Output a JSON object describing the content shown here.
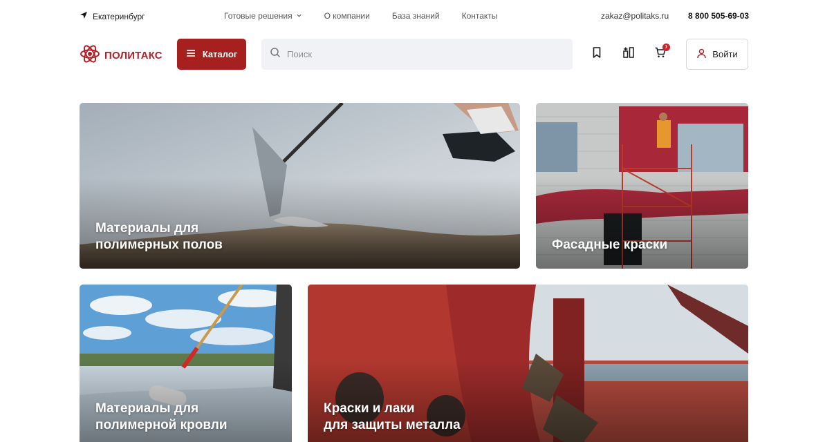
{
  "topbar": {
    "city": "Екатеринбург",
    "nav": [
      {
        "label": "Готовые решения",
        "has_dropdown": true
      },
      {
        "label": "О компании"
      },
      {
        "label": "База знаний"
      },
      {
        "label": "Контакты"
      }
    ],
    "email": "zakaz@politaks.ru",
    "phone": "8 800 505-69-03"
  },
  "header": {
    "logo_text": "ПОЛИТАКС",
    "catalog_label": "Каталог",
    "search_placeholder": "Поиск",
    "cart_count": "1",
    "login_label": "Войти",
    "icons": [
      "bookmark-icon",
      "compare-icon",
      "cart-icon",
      "user-icon"
    ]
  },
  "categories": [
    {
      "line1": "Материалы для",
      "line2": "полимерных полов"
    },
    {
      "line1": "Фасадные краски",
      "line2": ""
    },
    {
      "line1": "Материалы для",
      "line2": "полимерной кровли"
    },
    {
      "line1": "Краски и лаки",
      "line2": "для защиты металла"
    }
  ],
  "colors": {
    "brand": "#a5201f",
    "badge": "#c8242b",
    "search_bg": "#f1f2f5"
  }
}
